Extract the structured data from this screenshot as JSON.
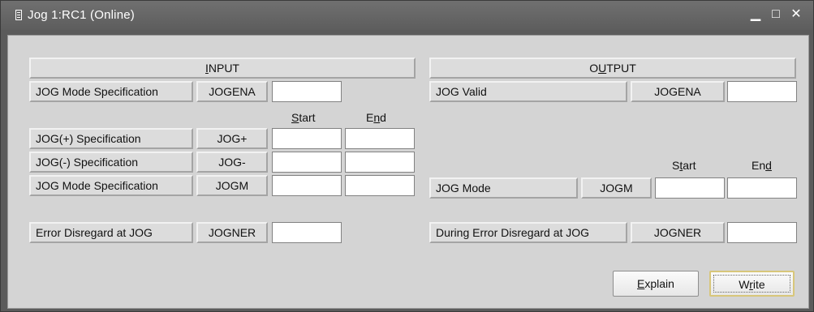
{
  "window": {
    "title": "Jog  1:RC1 (Online)",
    "icon": "document-icon",
    "controls": [
      "minimize-icon",
      "maximize-icon",
      "close-icon"
    ]
  },
  "input": {
    "header": {
      "pre": "",
      "mn": "I",
      "post": "NPUT"
    },
    "start_label": {
      "pre": "",
      "mn": "S",
      "post": "tart"
    },
    "end_label": {
      "pre": "E",
      "mn": "n",
      "post": "d"
    },
    "rows": [
      {
        "label": "JOG Mode Specification",
        "code": "JOGENA",
        "value": ""
      },
      {
        "label": "JOG(+) Specification",
        "code": "JOG+",
        "start": "",
        "end": ""
      },
      {
        "label": "JOG(-) Specification",
        "code": "JOG-",
        "start": "",
        "end": ""
      },
      {
        "label": "JOG Mode Specification",
        "code": "JOGM",
        "start": "",
        "end": ""
      },
      {
        "label": "Error Disregard at JOG",
        "code": "JOGNER",
        "value": ""
      }
    ]
  },
  "output": {
    "header": {
      "pre": "O",
      "mn": "U",
      "post": "TPUT"
    },
    "start_label": {
      "pre": "S",
      "mn": "t",
      "post": "art"
    },
    "end_label": {
      "pre": "En",
      "mn": "d",
      "post": ""
    },
    "rows": [
      {
        "label": "JOG Valid",
        "code": "JOGENA",
        "value": ""
      },
      {
        "label": "JOG Mode",
        "code": "JOGM",
        "start": "",
        "end": ""
      },
      {
        "label": "During Error Disregard at JOG",
        "code": "JOGNER",
        "value": ""
      }
    ]
  },
  "buttons": {
    "explain": {
      "pre": "",
      "mn": "E",
      "post": "xplain"
    },
    "write": {
      "pre": "W",
      "mn": "r",
      "post": "ite"
    }
  }
}
